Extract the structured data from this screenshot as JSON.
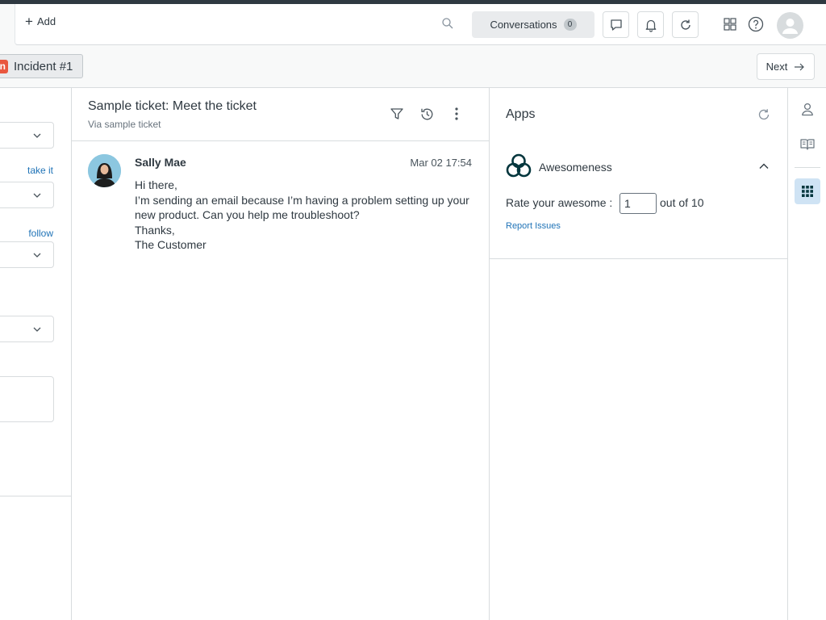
{
  "header": {
    "add_label": "Add",
    "conversations_label": "Conversations",
    "conversations_count": "0"
  },
  "tabs": {
    "incident_mark": "n",
    "incident_label": "Incident #1",
    "next_label": "Next"
  },
  "left_panel": {
    "take_it_link": "take it",
    "follow_link": "follow"
  },
  "ticket": {
    "title": "Sample ticket: Meet the ticket",
    "via": "Via sample ticket",
    "message": {
      "author": "Sally Mae",
      "time": "Mar 02 17:54",
      "body": "Hi there,\nI’m sending an email because I’m having a problem setting up your new product. Can you help me troubleshoot?\nThanks,\nThe Customer"
    }
  },
  "apps": {
    "title": "Apps",
    "app_name": "Awesomeness",
    "rate_label": "Rate your awesome :",
    "rate_value": "1",
    "rate_suffix": "out of 10",
    "report_link": "Report Issues"
  },
  "colors": {
    "link": "#1f73b7",
    "incident": "#e9573f",
    "rail_active": "#cfe3f4"
  },
  "icons": [
    "plus-icon",
    "search-icon",
    "chat-icon",
    "bell-icon",
    "refresh-icon",
    "grid-icon",
    "help-icon",
    "user-avatar-icon",
    "arrow-right-icon",
    "chevron-down-icon",
    "filter-icon",
    "history-icon",
    "more-vertical-icon",
    "app-logo-icon",
    "chevron-up-icon",
    "person-icon",
    "book-icon",
    "apps-grid-icon"
  ]
}
